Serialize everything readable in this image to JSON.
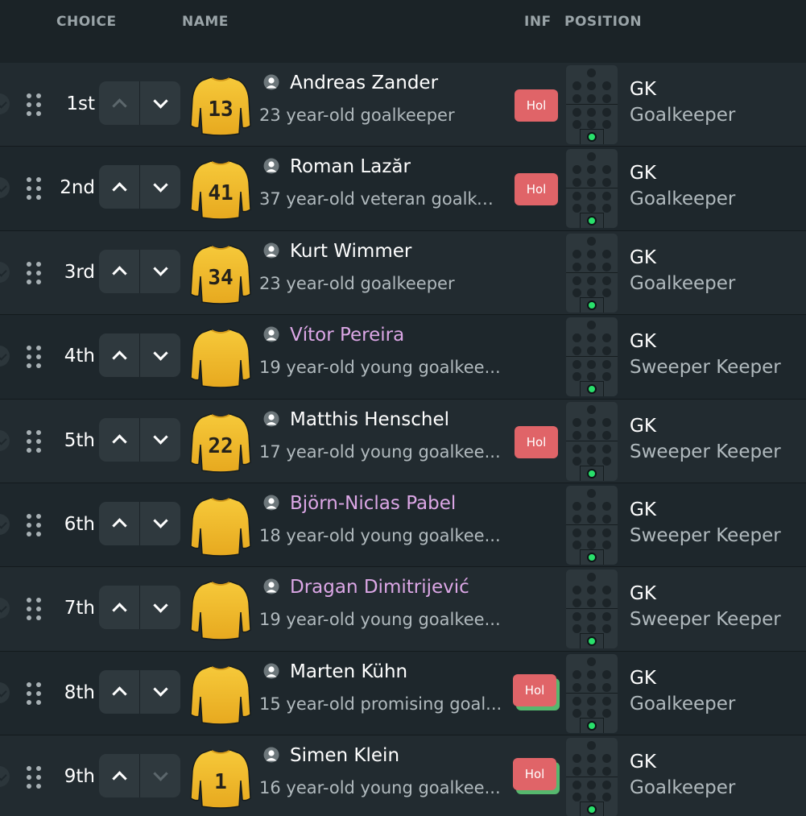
{
  "headers": {
    "choice": "CHOICE",
    "name": "NAME",
    "inf": "INF",
    "position": "POSITION"
  },
  "colors": {
    "background": "#1b2327",
    "shirt": "#f3bd2c",
    "badge": "#e06468",
    "gk_dot": "#29e06b",
    "highlight_name": "#dca7e6"
  },
  "rows": [
    {
      "rank": "1st",
      "name": "Andreas Zander",
      "name_style": "normal",
      "desc": "23 year-old goalkeeper",
      "shirt_number": "13",
      "badge": "Hol",
      "badge_stack": false,
      "pos_code": "GK",
      "pos_role": "Goalkeeper",
      "up_enabled": false,
      "down_enabled": true
    },
    {
      "rank": "2nd",
      "name": "Roman Lazăr",
      "name_style": "normal",
      "desc": "37 year-old veteran goalke...",
      "shirt_number": "41",
      "badge": "Hol",
      "badge_stack": false,
      "pos_code": "GK",
      "pos_role": "Goalkeeper",
      "up_enabled": true,
      "down_enabled": true
    },
    {
      "rank": "3rd",
      "name": "Kurt Wimmer",
      "name_style": "normal",
      "desc": "23 year-old goalkeeper",
      "shirt_number": "34",
      "badge": "",
      "badge_stack": false,
      "pos_code": "GK",
      "pos_role": "Goalkeeper",
      "up_enabled": true,
      "down_enabled": true
    },
    {
      "rank": "4th",
      "name": "Vítor Pereira",
      "name_style": "pink",
      "desc": "19 year-old young goalkee...",
      "shirt_number": "",
      "badge": "",
      "badge_stack": false,
      "pos_code": "GK",
      "pos_role": "Sweeper Keeper",
      "up_enabled": true,
      "down_enabled": true
    },
    {
      "rank": "5th",
      "name": "Matthis Henschel",
      "name_style": "normal",
      "desc": "17 year-old young goalkee...",
      "shirt_number": "22",
      "badge": "Hol",
      "badge_stack": false,
      "pos_code": "GK",
      "pos_role": "Sweeper Keeper",
      "up_enabled": true,
      "down_enabled": true
    },
    {
      "rank": "6th",
      "name": "Björn-Niclas Pabel",
      "name_style": "pink",
      "desc": "18 year-old young goalkee...",
      "shirt_number": "",
      "badge": "",
      "badge_stack": false,
      "pos_code": "GK",
      "pos_role": "Sweeper Keeper",
      "up_enabled": true,
      "down_enabled": true
    },
    {
      "rank": "7th",
      "name": "Dragan Dimitrijević",
      "name_style": "pink",
      "desc": "19 year-old young goalkee...",
      "shirt_number": "",
      "badge": "",
      "badge_stack": false,
      "pos_code": "GK",
      "pos_role": "Sweeper Keeper",
      "up_enabled": true,
      "down_enabled": true
    },
    {
      "rank": "8th",
      "name": "Marten Kühn",
      "name_style": "normal",
      "desc": "15 year-old promising goal...",
      "shirt_number": "",
      "badge": "Hol",
      "badge_stack": true,
      "pos_code": "GK",
      "pos_role": "Goalkeeper",
      "up_enabled": true,
      "down_enabled": true
    },
    {
      "rank": "9th",
      "name": "Simen Klein",
      "name_style": "normal",
      "desc": "16 year-old young goalkee...",
      "shirt_number": "1",
      "badge": "Hol",
      "badge_stack": true,
      "pos_code": "GK",
      "pos_role": "Goalkeeper",
      "up_enabled": true,
      "down_enabled": false
    }
  ]
}
